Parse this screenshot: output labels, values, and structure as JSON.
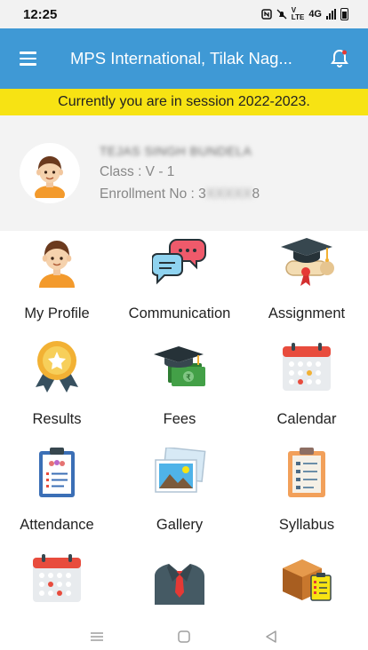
{
  "status_bar": {
    "time": "12:25",
    "icons": [
      "nfc-icon",
      "mute-icon",
      "volte-icon",
      "signal-icon",
      "battery-icon"
    ],
    "network_label": "4G"
  },
  "app_bar": {
    "title": "MPS International, Tilak Nag...",
    "menu_icon": "menu-icon",
    "notification_icon": "bell-icon"
  },
  "session_banner": {
    "text": "Currently you are in session 2022-2023."
  },
  "profile": {
    "name": "TEJAS SINGH BUNDELA",
    "class_line": "Class : V - 1",
    "enrollment_label": "Enrollment No : 3",
    "enrollment_hidden": "XXXXX",
    "enrollment_suffix": "8"
  },
  "tiles": [
    {
      "label": "My Profile",
      "icon": "profile-icon"
    },
    {
      "label": "Communication",
      "icon": "chat-bubbles-icon"
    },
    {
      "label": "Assignment",
      "icon": "graduation-scroll-icon"
    },
    {
      "label": "Results",
      "icon": "award-ribbon-icon"
    },
    {
      "label": "Fees",
      "icon": "fees-money-icon"
    },
    {
      "label": "Calendar",
      "icon": "calendar-icon"
    },
    {
      "label": "Attendance",
      "icon": "attendance-clipboard-icon"
    },
    {
      "label": "Gallery",
      "icon": "gallery-photos-icon"
    },
    {
      "label": "Syllabus",
      "icon": "syllabus-clipboard-icon"
    },
    {
      "label": "",
      "icon": "calendar-icon"
    },
    {
      "label": "",
      "icon": "teacher-suit-icon"
    },
    {
      "label": "",
      "icon": "box-checklist-icon"
    }
  ],
  "colors": {
    "app_bar": "#3f99d5",
    "session_banner": "#f7e313",
    "profile_bg": "#f3f3f3"
  }
}
